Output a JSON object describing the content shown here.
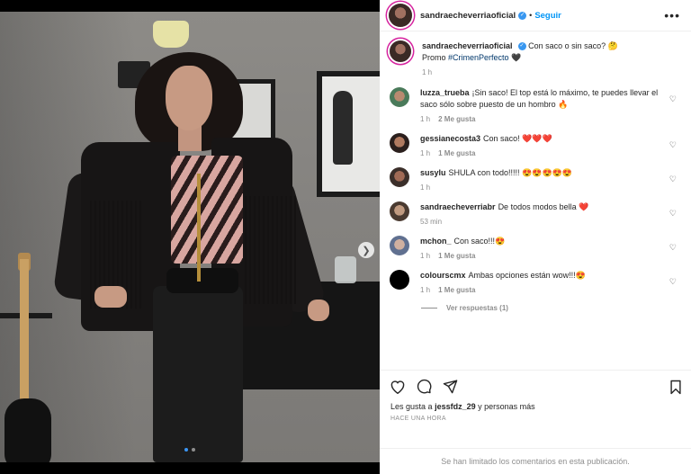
{
  "post": {
    "author": "sandraecheverriaoficial",
    "verified": true,
    "follow_label": "Seguir",
    "separator": "•",
    "more_icon": "more-horizontal-icon",
    "caption_text": "Con saco o sin saco? 🤔",
    "caption_promo": "Promo",
    "caption_hashtag": "#CrimenPerfecto",
    "caption_tail": "🖤",
    "caption_time": "1 h"
  },
  "photo": {
    "carousel_total": 2,
    "carousel_active": 1,
    "next_icon": "chevron-right-icon"
  },
  "comments": [
    {
      "user": "luzza_trueba",
      "text": "¡Sin saco! El top está lo máximo, te puedes llevar el saco sólo sobre puesto de un hombro 🔥",
      "time": "1 h",
      "likes": "2 Me gusta"
    },
    {
      "user": "gessianecosta3",
      "text": "Con saco! ❤️❤️❤️",
      "time": "1 h",
      "likes": "1 Me gusta"
    },
    {
      "user": "susylu",
      "text": "SHULA con todo!!!!! 😍😍😍😍😍",
      "time": "1 h",
      "likes": ""
    },
    {
      "user": "sandraecheverriabr",
      "text": "De todos modos bella ❤️",
      "time": "53 min",
      "likes": ""
    },
    {
      "user": "mchon_",
      "text": "Con saco!!!😍",
      "time": "1 h",
      "likes": "1 Me gusta"
    },
    {
      "user": "colourscmx",
      "text": "Ambas opciones están wow!!!😍",
      "time": "1 h",
      "likes": "1 Me gusta"
    }
  ],
  "replies_label": "Ver respuestas (1)",
  "likes_text_prefix": "Les gusta a",
  "likes_user": "jessfdz_29",
  "likes_text_suffix": "y personas más",
  "post_time": "HACE UNA HORA",
  "limited_notice": "Se han limitado los comentarios en esta publicación."
}
